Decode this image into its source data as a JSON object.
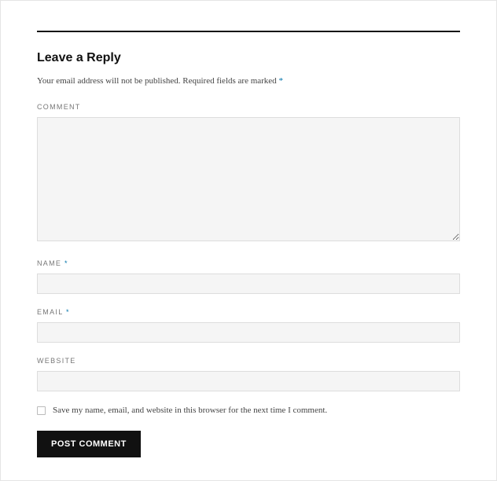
{
  "heading": "Leave a Reply",
  "notes_part1": "Your email address will not be published.",
  "notes_part2": "Required fields are marked ",
  "required_mark": "*",
  "fields": {
    "comment": {
      "label": "COMMENT",
      "value": ""
    },
    "name": {
      "label": "NAME ",
      "value": "",
      "required": true
    },
    "email": {
      "label": "EMAIL ",
      "value": "",
      "required": true
    },
    "website": {
      "label": "WEBSITE",
      "value": ""
    }
  },
  "consent": {
    "label": "Save my name, email, and website in this browser for the next time I comment.",
    "checked": false
  },
  "submit_label": "POST COMMENT"
}
